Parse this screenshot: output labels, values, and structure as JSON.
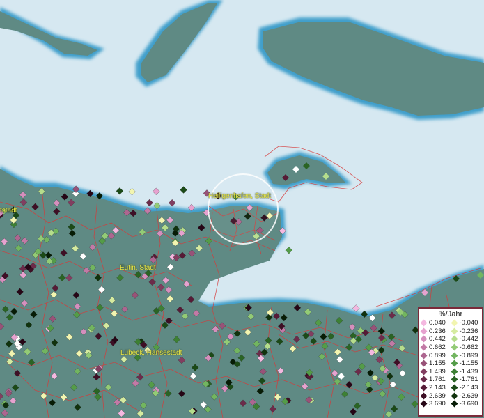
{
  "map": {
    "labels": [
      {
        "id": "stadt-left",
        "text": "tstadt"
      },
      {
        "id": "heiligenhafen",
        "text": "Heiligenhafen, Stadt"
      },
      {
        "id": "eutin",
        "text": "Eutin, Stadt"
      },
      {
        "id": "luebeck",
        "text": "Lübeck, Hansestadt"
      }
    ],
    "colors": {
      "water": "#d6e8f1",
      "land": "#5f8a84",
      "coast": "#4da6cc",
      "boundary": "#d63a3a",
      "focus_ring": "#ffffff"
    }
  },
  "legend": {
    "title": "%/Jahr",
    "positive": [
      {
        "value": "0.040",
        "color": "#f4b8e0"
      },
      {
        "value": "0.236",
        "color": "#e6a2cf"
      },
      {
        "value": "0.442",
        "color": "#d58fbd"
      },
      {
        "value": "0.662",
        "color": "#c27aa6"
      },
      {
        "value": "0.899",
        "color": "#ad6690"
      },
      {
        "value": "1.155",
        "color": "#985278"
      },
      {
        "value": "1.439",
        "color": "#823e60"
      },
      {
        "value": "1.761",
        "color": "#6c2b4a"
      },
      {
        "value": "2.143",
        "color": "#561b36"
      },
      {
        "value": "2.639",
        "color": "#3e0f25"
      },
      {
        "value": "3.690",
        "color": "#260616"
      }
    ],
    "negative": [
      {
        "value": "-0.040",
        "color": "#f2f5b0"
      },
      {
        "value": "-0.236",
        "color": "#d5eba0"
      },
      {
        "value": "-0.442",
        "color": "#b5dd8c"
      },
      {
        "value": "-0.662",
        "color": "#93cb76"
      },
      {
        "value": "-0.899",
        "color": "#72b560"
      },
      {
        "value": "-1.155",
        "color": "#549c48"
      },
      {
        "value": "-1.439",
        "color": "#3d8034"
      },
      {
        "value": "-1.761",
        "color": "#2a6424"
      },
      {
        "value": "-2.143",
        "color": "#1b4a17"
      },
      {
        "value": "-2.639",
        "color": "#10320d"
      },
      {
        "value": "-3.690",
        "color": "#061c05"
      }
    ]
  }
}
